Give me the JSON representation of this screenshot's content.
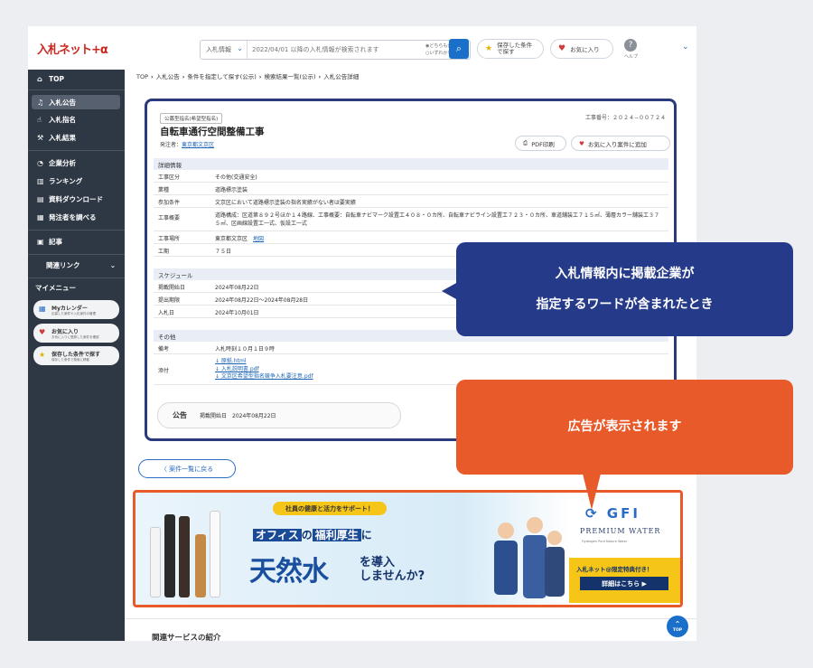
{
  "header": {
    "logo": "入札ネット+α",
    "search_category": "入札情報",
    "search_placeholder": "2022/04/01 以降の入札情報が検索されます",
    "radio1": "◉どちらも含む",
    "radio2": "○いずれかを含む",
    "saved_label": "保存した条件で探す",
    "favorites_label": "お気に入り",
    "help_label": "ヘルプ"
  },
  "sidebar": {
    "top": "TOP",
    "items": [
      "入札公告",
      "入札指名",
      "入札結果",
      "企業分析",
      "ランキング",
      "資料ダウンロード",
      "発注者を調べる",
      "記事"
    ],
    "related": "関連リンク",
    "mymenu": "マイメニュー",
    "cards": [
      {
        "title": "Myカレンダー",
        "sub": "応募した案件や入札案件の管理"
      },
      {
        "title": "お気に入り",
        "sub": "お気に入りに登録した案件を確認"
      },
      {
        "title": "保存した条件で探す",
        "sub": "保存した条件で検索に移動"
      }
    ]
  },
  "breadcrumb": [
    "TOP",
    "入札公告",
    "条件を指定して探す(公示)",
    "検索結果一覧(公示)",
    "入札公告詳細"
  ],
  "detail": {
    "tag": "公募型指名(希望型指名)",
    "case_no": "工事番号：２０２４−００７２４",
    "title": "自転車通行空間整備工事",
    "orderer_label": "発注者：",
    "orderer": "東京都文京区",
    "pdf_btn": "PDF印刷",
    "fav_btn": "お気に入り案件に追加",
    "section1": "詳細情報",
    "rows1": [
      {
        "k": "工事区分",
        "v": "その他(交通安全)"
      },
      {
        "k": "業種",
        "v": "道路標示塗装"
      },
      {
        "k": "参加条件",
        "v": "文京区において道路標示塗装の指名実績がない者は要実績"
      },
      {
        "k": "工事概要",
        "v": "道路構成：区道第８９２号ほか１４路線、工事概要：自転車ナビマーク設置工４０８・０カ所、自転車ナビライン設置工７２３・０カ所、車道舗装工７１５㎡、薄層カラー舗装工３７５㎡、区画線設置工一式、仮設工一式"
      },
      {
        "k": "工事場所",
        "v": "東京都文京区",
        "link": "地図"
      },
      {
        "k": "工期",
        "v": "７５日"
      }
    ],
    "section2": "スケジュール",
    "rows2": [
      {
        "k": "掲載開始日",
        "v": "2024年08月22日"
      },
      {
        "k": "提出期限",
        "v": "2024年08月22日～2024年08月28日"
      },
      {
        "k": "入札日",
        "v": "2024年10月01日"
      }
    ],
    "section3": "その他",
    "rows3": [
      {
        "k": "備考",
        "v": "入札時刻１０月１日９時"
      }
    ],
    "attach_label": "添付",
    "attachments": [
      "↓ 原紙.html",
      "↓ 入札説明書.pdf",
      "↓ 文京区希望型指名競争入札要注意.pdf"
    ],
    "pub_label": "公告",
    "pub_text": "掲載開始日　2024年08月22日"
  },
  "back_btn": "〈 案件一覧に戻る",
  "ad": {
    "top": "社員の健康と活力をサポート！",
    "line1_a": "オフィス",
    "line1_b": "の",
    "line1_c": "福利厚生",
    "line1_d": "に",
    "big": "天然水",
    "big2_a": "を導入",
    "big2_b": "しませんか?",
    "brand": "GFI",
    "pw": "PREMIUM WATER",
    "pws": "Hydrogen  Pure  Nature  Water",
    "special": "入札ネット@限定特典付き！",
    "cta": "詳細はこちら ▶"
  },
  "related_title": "関連サービスの紹介",
  "totop": "TOP",
  "callout1": [
    "入札情報内に掲載企業が",
    "指定するワードが含まれたとき"
  ],
  "callout2": "広告が表示されます",
  "colors": {
    "navy": "#263a8a",
    "orange": "#e85a2a",
    "sidebar": "#2e3845",
    "accent": "#1a6fc9"
  }
}
